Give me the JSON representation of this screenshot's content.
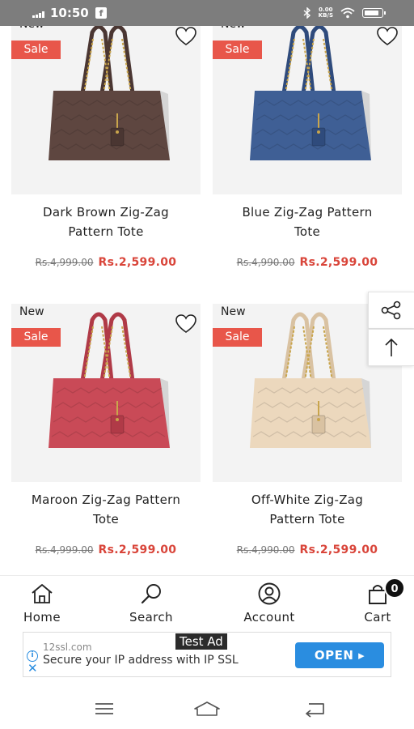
{
  "status_bar": {
    "time": "10:50",
    "notification_icon": "facebook-icon",
    "speed_top": "0.00",
    "speed_bottom": "KB/S",
    "icons": [
      "signal-icon",
      "bluetooth-icon",
      "wifi-icon",
      "battery-icon"
    ]
  },
  "colors": {
    "sale_badge": "#e8564a",
    "sale_price": "#d9453a",
    "ad_button": "#2a8de0"
  },
  "products": [
    {
      "name_line1": "Dark Brown Zig-Zag",
      "name_line2": "Pattern Tote",
      "badge_new": "New",
      "badge_sale": "Sale",
      "price_old": "Rs.4,999.00",
      "price_new": "Rs.2,599.00",
      "bag_color": "#5e4640",
      "handle_color": "#4a3632"
    },
    {
      "name_line1": "Blue Zig-Zag Pattern",
      "name_line2": "Tote",
      "badge_new": "New",
      "badge_sale": "Sale",
      "price_old": "Rs.4,990.00",
      "price_new": "Rs.2,599.00",
      "bag_color": "#3f5f95",
      "handle_color": "#2f4b7c"
    },
    {
      "name_line1": "Maroon Zig-Zag Pattern",
      "name_line2": "Tote",
      "badge_new": "New",
      "badge_sale": "Sale",
      "price_old": "Rs.4,999.00",
      "price_new": "Rs.2,599.00",
      "bag_color": "#c94a57",
      "handle_color": "#b03a47"
    },
    {
      "name_line1": "Off-White Zig-Zag",
      "name_line2": "Pattern Tote",
      "badge_new": "New",
      "badge_sale": "Sale",
      "price_old": "Rs.4,990.00",
      "price_new": "Rs.2,599.00",
      "bag_color": "#ecd8bd",
      "handle_color": "#d9c2a2"
    }
  ],
  "float_buttons": {
    "share_icon": "share-icon",
    "top_icon": "arrow-up-icon"
  },
  "bottom_nav": {
    "home": "Home",
    "search": "Search",
    "account": "Account",
    "cart": "Cart",
    "cart_count": "0"
  },
  "ad": {
    "label": "Test Ad",
    "domain": "12ssl.com",
    "text": "Secure your IP address with IP SSL",
    "button": "OPEN ▸"
  },
  "system_nav": {
    "icons": [
      "menu-icon",
      "home-icon",
      "back-icon"
    ]
  }
}
